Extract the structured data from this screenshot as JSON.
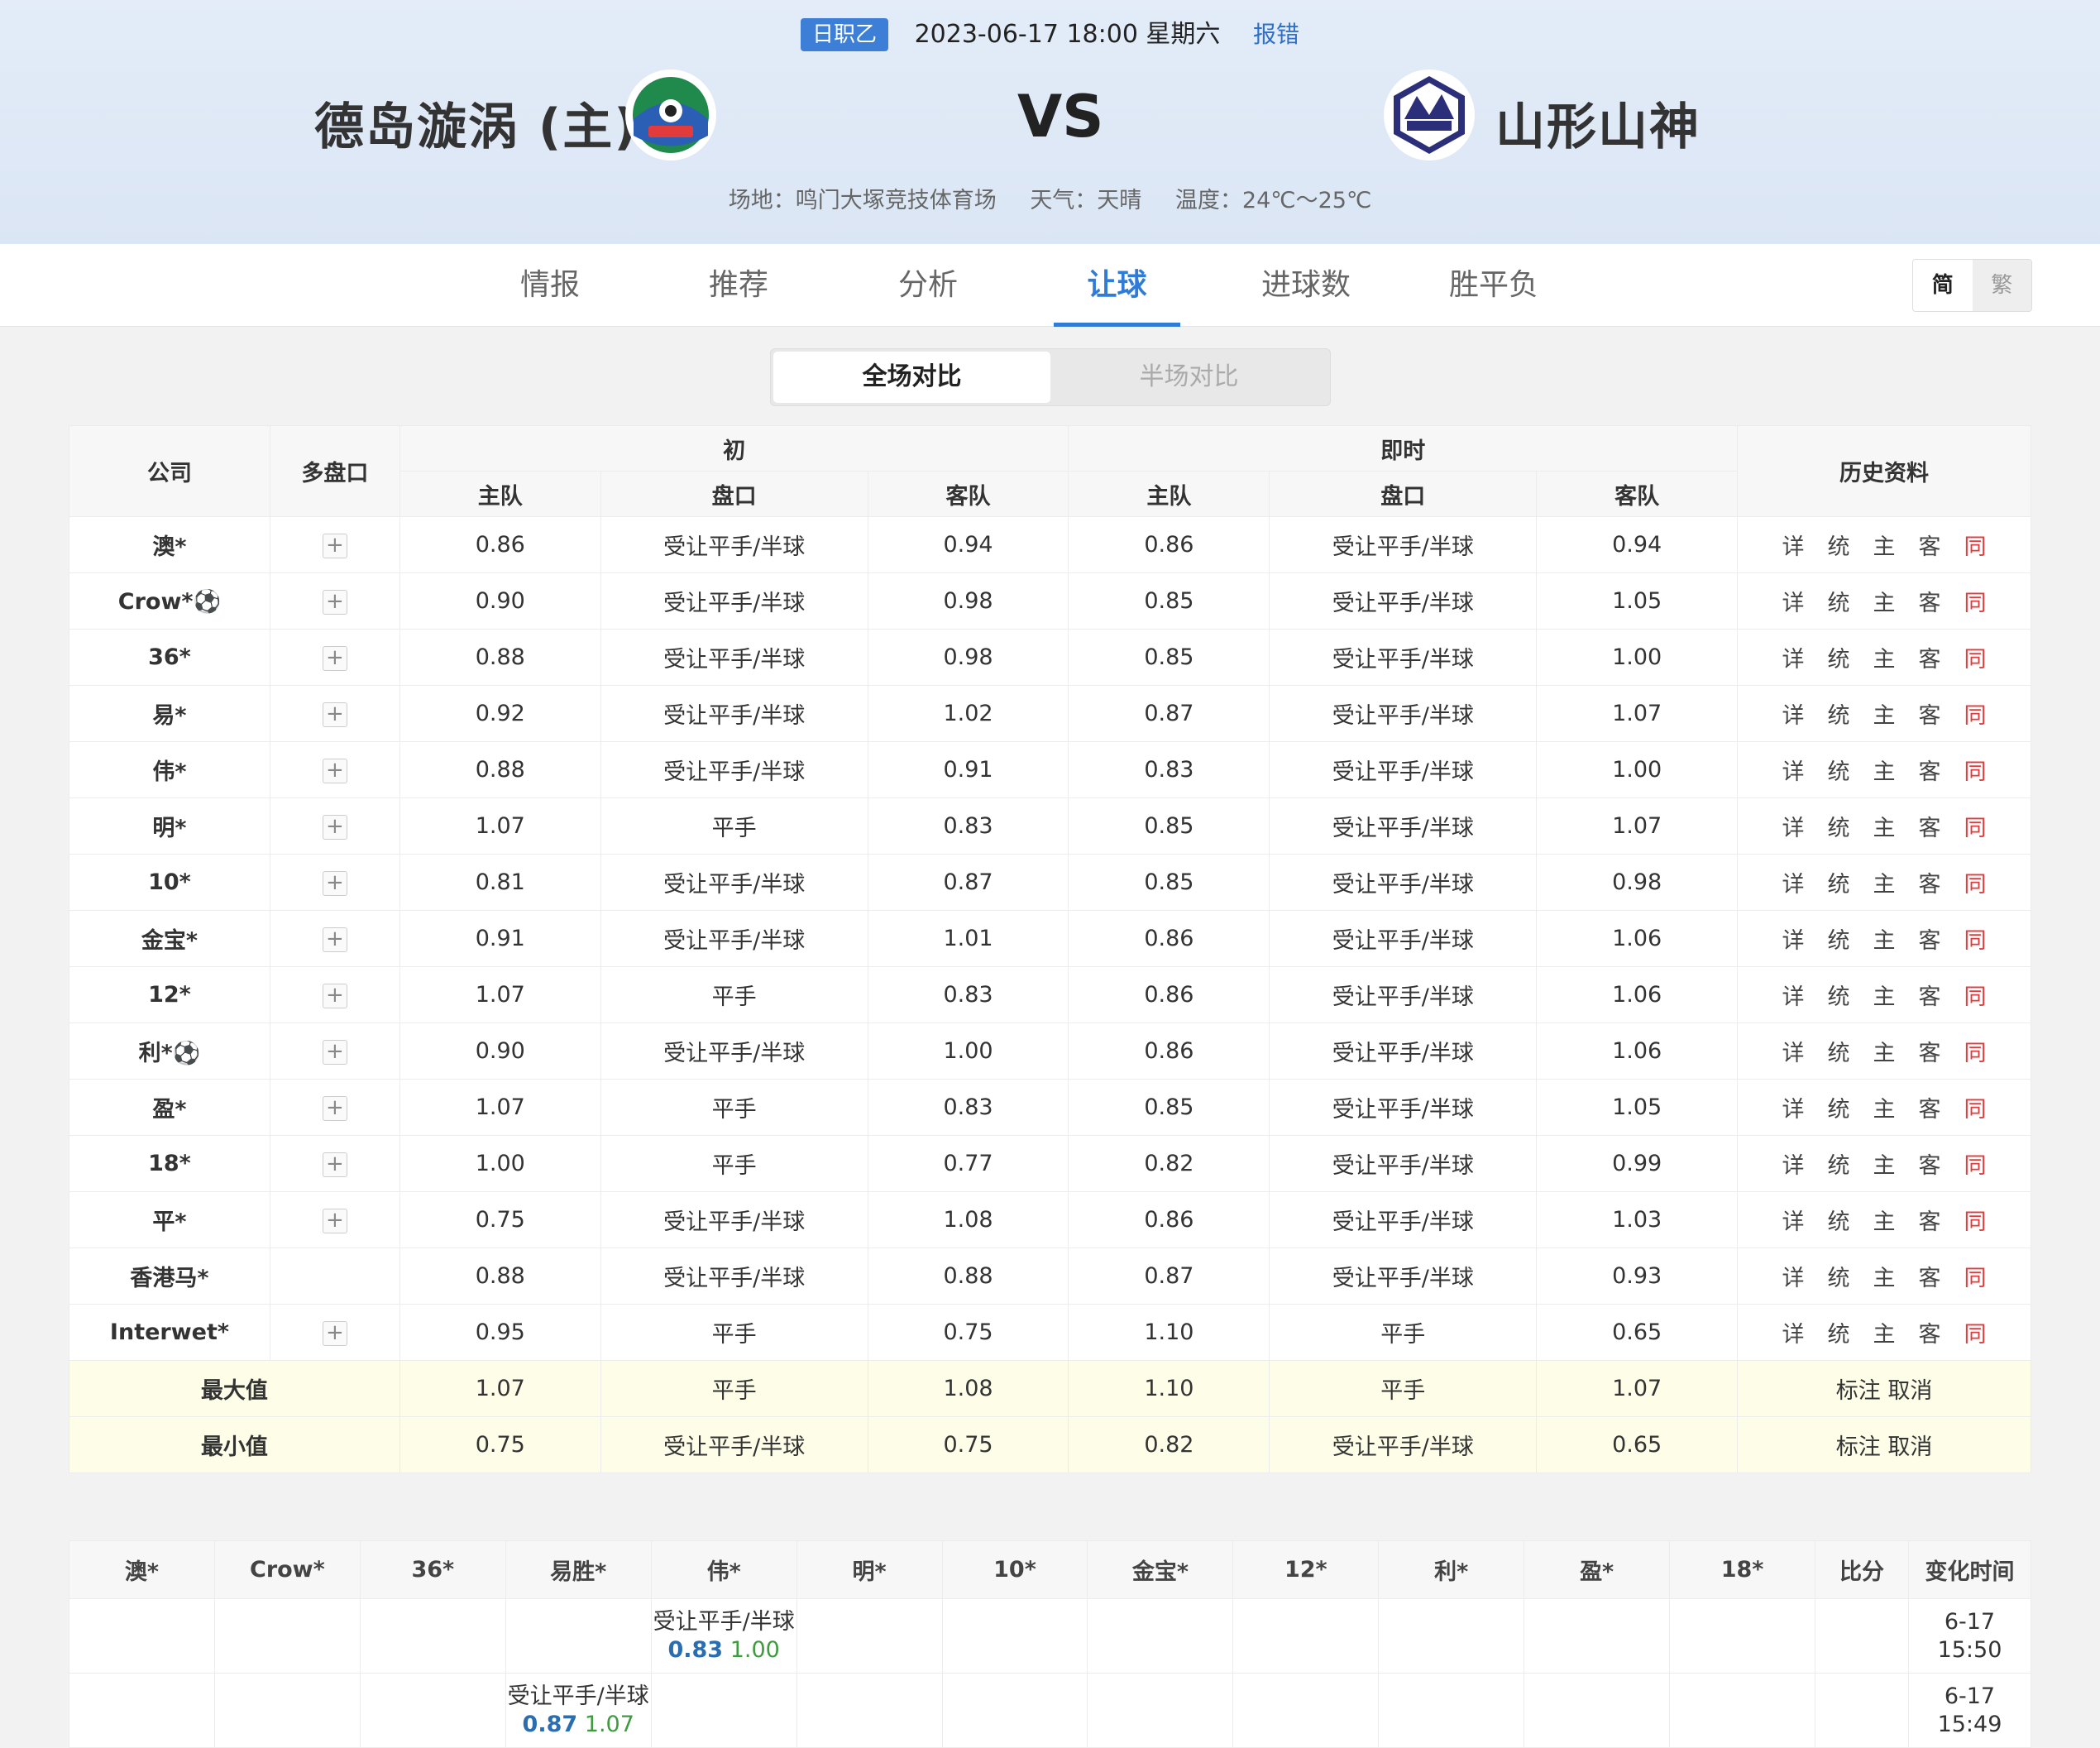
{
  "header": {
    "league": "日职乙",
    "datetime": "2023-06-17 18:00 星期六",
    "report": "报错",
    "home_team": "德岛漩涡 (主)",
    "vs": "VS",
    "away_team": "山形山神",
    "venue": "场地：鸣门大塚竞技体育场",
    "weather": "天气：天晴",
    "temperature": "温度：24℃～25℃"
  },
  "tabs": [
    "情报",
    "推荐",
    "分析",
    "让球",
    "进球数",
    "胜平负"
  ],
  "active_tab": "让球",
  "lang": {
    "simplified": "简",
    "traditional": "繁"
  },
  "segment": {
    "full": "全场对比",
    "half": "半场对比"
  },
  "table_headers": {
    "company": "公司",
    "multi": "多盘口",
    "initial": "初",
    "live": "即时",
    "history": "历史资料",
    "home": "主队",
    "line": "盘口",
    "away": "客队"
  },
  "history_links": [
    "详",
    "统",
    "主",
    "客",
    "同"
  ],
  "rows": [
    {
      "company": "澳*",
      "plus": true,
      "i_home": "0.86",
      "i_line": "受让平手/半球",
      "i_away": "0.94",
      "l_home": "0.86",
      "l_line": "受让平手/半球",
      "l_away": "0.94"
    },
    {
      "company": "Crow*⚽",
      "plus": true,
      "i_home": "0.90",
      "i_line": "受让平手/半球",
      "i_away": "0.98",
      "l_home": "0.85",
      "l_line": "受让平手/半球",
      "l_away": "1.05"
    },
    {
      "company": "36*",
      "plus": true,
      "i_home": "0.88",
      "i_line": "受让平手/半球",
      "i_away": "0.98",
      "l_home": "0.85",
      "l_line": "受让平手/半球",
      "l_away": "1.00"
    },
    {
      "company": "易*",
      "plus": true,
      "i_home": "0.92",
      "i_line": "受让平手/半球",
      "i_away": "1.02",
      "l_home": "0.87",
      "l_line": "受让平手/半球",
      "l_away": "1.07"
    },
    {
      "company": "伟*",
      "plus": true,
      "i_home": "0.88",
      "i_line": "受让平手/半球",
      "i_away": "0.91",
      "l_home": "0.83",
      "l_line": "受让平手/半球",
      "l_away": "1.00"
    },
    {
      "company": "明*",
      "plus": true,
      "i_home": "1.07",
      "i_line": "平手",
      "i_away": "0.83",
      "l_home": "0.85",
      "l_line": "受让平手/半球",
      "l_away": "1.07"
    },
    {
      "company": "10*",
      "plus": true,
      "i_home": "0.81",
      "i_line": "受让平手/半球",
      "i_away": "0.87",
      "l_home": "0.85",
      "l_line": "受让平手/半球",
      "l_away": "0.98"
    },
    {
      "company": "金宝*",
      "plus": true,
      "i_home": "0.91",
      "i_line": "受让平手/半球",
      "i_away": "1.01",
      "l_home": "0.86",
      "l_line": "受让平手/半球",
      "l_away": "1.06"
    },
    {
      "company": "12*",
      "plus": true,
      "i_home": "1.07",
      "i_line": "平手",
      "i_away": "0.83",
      "l_home": "0.86",
      "l_line": "受让平手/半球",
      "l_away": "1.06"
    },
    {
      "company": "利*⚽",
      "plus": true,
      "i_home": "0.90",
      "i_line": "受让平手/半球",
      "i_away": "1.00",
      "l_home": "0.86",
      "l_line": "受让平手/半球",
      "l_away": "1.06"
    },
    {
      "company": "盈*",
      "plus": true,
      "i_home": "1.07",
      "i_line": "平手",
      "i_away": "0.83",
      "l_home": "0.85",
      "l_line": "受让平手/半球",
      "l_away": "1.05"
    },
    {
      "company": "18*",
      "plus": true,
      "i_home": "1.00",
      "i_line": "平手",
      "i_away": "0.77",
      "l_home": "0.82",
      "l_line": "受让平手/半球",
      "l_away": "0.99"
    },
    {
      "company": "平*",
      "plus": true,
      "i_home": "0.75",
      "i_line": "受让平手/半球",
      "i_away": "1.08",
      "l_home": "0.86",
      "l_line": "受让平手/半球",
      "l_away": "1.03"
    },
    {
      "company": "香港马*",
      "plus": false,
      "i_home": "0.88",
      "i_line": "受让平手/半球",
      "i_away": "0.88",
      "l_home": "0.87",
      "l_line": "受让平手/半球",
      "l_away": "0.93"
    },
    {
      "company": "Interwet*",
      "plus": true,
      "i_home": "0.95",
      "i_line": "平手",
      "i_away": "0.75",
      "l_home": "1.10",
      "l_line": "平手",
      "l_away": "0.65"
    }
  ],
  "summary": [
    {
      "label": "最大值",
      "i_home": "1.07",
      "i_line": "平手",
      "i_away": "1.08",
      "l_home": "1.10",
      "l_line": "平手",
      "l_away": "1.07",
      "action": "标注 取消"
    },
    {
      "label": "最小值",
      "i_home": "0.75",
      "i_line": "受让平手/半球",
      "i_away": "0.75",
      "l_home": "0.82",
      "l_line": "受让平手/半球",
      "l_away": "0.65",
      "action": "标注 取消"
    }
  ],
  "change_headers": [
    "澳*",
    "Crow*",
    "36*",
    "易胜*",
    "伟*",
    "明*",
    "10*",
    "金宝*",
    "12*",
    "利*",
    "盈*",
    "18*",
    "比分",
    "变化时间"
  ],
  "change_rows": [
    {
      "col": 4,
      "line": "受让平手/半球",
      "home": "0.83",
      "away": "1.00",
      "time": "6-17 15:50"
    },
    {
      "col": 3,
      "line": "受让平手/半球",
      "home": "0.87",
      "away": "1.07",
      "time": "6-17 15:49"
    }
  ],
  "colors": {
    "accent": "#2f7bd6",
    "badge": "#3d7fd6",
    "same_link": "#e23b3b",
    "summary_bg": "#fdfde8"
  }
}
